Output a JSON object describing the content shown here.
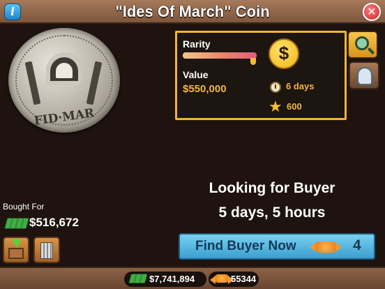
{
  "header": {
    "title": "\"Ides Of March\" Coin",
    "info_icon": "i",
    "close_icon": "✕"
  },
  "coin": {
    "inscription": "FID·MAR"
  },
  "details": {
    "rarity_label": "Rarity",
    "rarity_level": 0.95,
    "value_label": "Value",
    "value_amount": "$550,000",
    "currency_symbol": "$",
    "duration": "6 days",
    "xp": "600"
  },
  "status": {
    "title": "Looking for Buyer",
    "time_left": "5 days, 5 hours"
  },
  "purchase": {
    "label": "Bought For",
    "amount": "$516,672"
  },
  "actions": {
    "find_buyer_label": "Find Buyer Now",
    "find_buyer_cost": "4"
  },
  "wallet": {
    "cash": "$7,741,894",
    "candy": "55344"
  },
  "colors": {
    "accent_gold": "#f3b53b",
    "button_blue": "#3b9fd0",
    "header_brown": "#7d563c"
  },
  "icons": [
    "info-icon",
    "close-icon",
    "dollar-icon",
    "clock-icon",
    "star-icon",
    "magnifier-icon",
    "expert-head-icon",
    "cash-icon",
    "store-icon",
    "trash-icon",
    "candy-icon"
  ]
}
